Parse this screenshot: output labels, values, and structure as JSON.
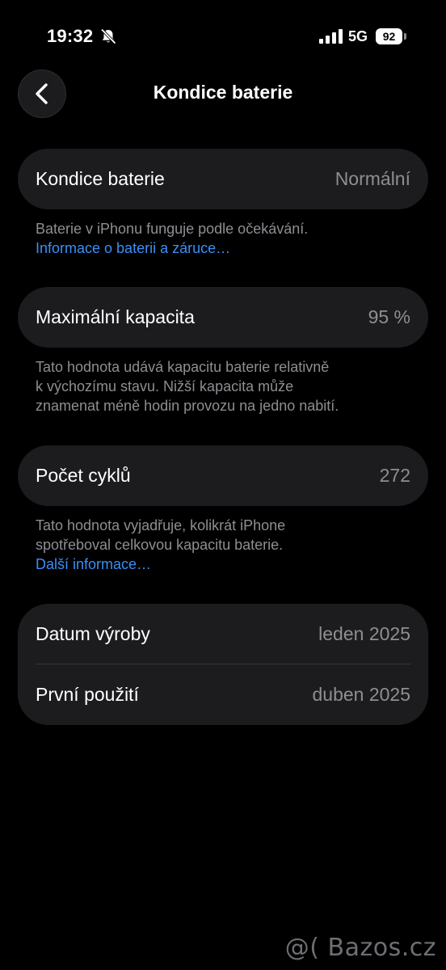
{
  "status_bar": {
    "time": "19:32",
    "network": "5G",
    "battery_level": "92",
    "icons": [
      "bell-slash-icon",
      "signal-bars-icon",
      "battery-icon"
    ]
  },
  "nav": {
    "title": "Kondice baterie",
    "back_icon": "chevron-left-icon"
  },
  "health": {
    "label": "Kondice baterie",
    "value": "Normální",
    "note": "Baterie v iPhonu funguje podle očekávání.",
    "link": "Informace o baterii a záruce…"
  },
  "capacity": {
    "label": "Maximální kapacita",
    "value": "95 %",
    "note_lines": [
      "Tato hodnota udává kapacitu baterie relativně",
      "k výchozímu stavu. Nižší kapacita může",
      "znamenat méně hodin provozu na jedno nabití."
    ]
  },
  "cycles": {
    "label": "Počet cyklů",
    "value": "272",
    "note_lines": [
      "Tato hodnota vyjadřuje, kolikrát iPhone",
      "spotřeboval celkovou kapacitu baterie."
    ],
    "link": "Další informace…"
  },
  "dates": {
    "manufacture_label": "Datum výroby",
    "manufacture_value": "leden 2025",
    "first_use_label": "První použití",
    "first_use_value": "duben 2025"
  },
  "watermark": "@( Bazos.cz",
  "colors": {
    "background": "#000000",
    "card": "#1c1c1e",
    "secondary_text": "#8e8e93",
    "link": "#3b8ff6"
  }
}
